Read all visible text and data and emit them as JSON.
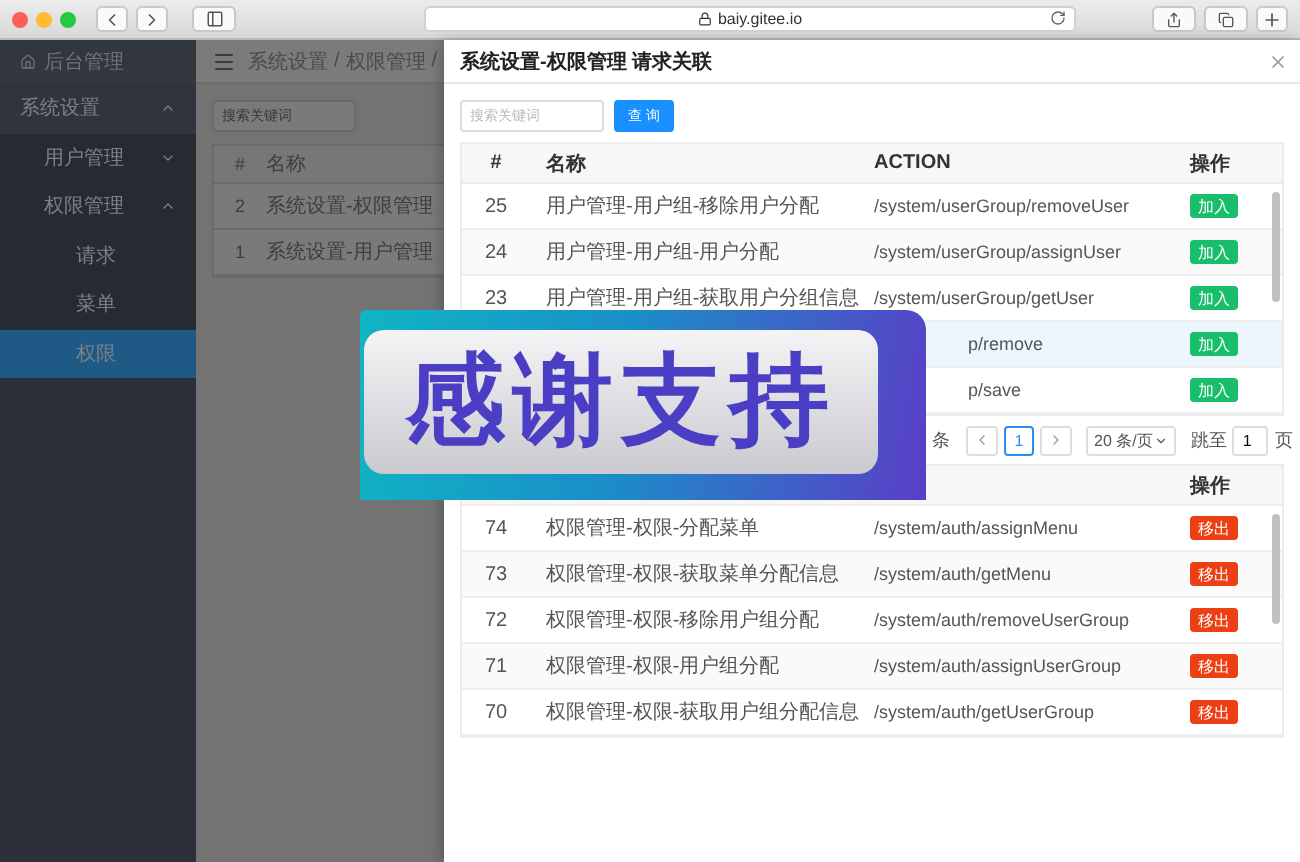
{
  "browser": {
    "url": "baiy.gitee.io"
  },
  "sidebar": {
    "title": "后台管理",
    "items": [
      {
        "label": "系统设置",
        "expanded": true,
        "children": [
          {
            "label": "用户管理",
            "expanded": false
          },
          {
            "label": "权限管理",
            "expanded": true,
            "children": [
              {
                "label": "请求",
                "selected": false
              },
              {
                "label": "菜单",
                "selected": false
              },
              {
                "label": "权限",
                "selected": true
              }
            ]
          }
        ]
      }
    ]
  },
  "main": {
    "breadcrumb": [
      "系统设置",
      "/",
      "权限管理",
      "/"
    ],
    "search": {
      "placeholder": "搜索关键词"
    },
    "table": {
      "columns": [
        "#",
        "名称"
      ],
      "rows": [
        [
          "2",
          "系统设置-权限管理"
        ],
        [
          "1",
          "系统设置-用户管理"
        ]
      ]
    }
  },
  "drawer": {
    "title": "系统设置-权限管理 请求关联",
    "search": {
      "placeholder": "搜索关键词"
    },
    "query_button": "查 询",
    "available": {
      "kind": "add",
      "columns": [
        "#",
        "名称",
        "ACTION",
        "操作"
      ],
      "rows": [
        {
          "id": "25",
          "name": "用户管理-用户组-移除用户分配",
          "action": "/system/userGroup/removeUser",
          "button": "加入",
          "highlighted": false,
          "covered": false
        },
        {
          "id": "24",
          "name": "用户管理-用户组-用户分配",
          "action": "/system/userGroup/assignUser",
          "button": "加入",
          "highlighted": false,
          "covered": false
        },
        {
          "id": "23",
          "name": "用户管理-用户组-获取用户分组信息",
          "action": "/system/userGroup/getUser",
          "button": "加入",
          "highlighted": false,
          "covered": false
        },
        {
          "action": "p/remove",
          "button": "加入",
          "highlighted": true,
          "covered": true
        },
        {
          "action": "p/save",
          "button": "加入",
          "highlighted": false,
          "covered": true
        }
      ]
    },
    "pagination": {
      "total": "条",
      "pages": [
        {
          "label": "1",
          "selected": true
        }
      ],
      "page_size": "20 条/页",
      "jump_label": "跳至",
      "jump_value": "1",
      "page_suffix": "页"
    },
    "assigned": {
      "kind": "remove",
      "columns": [
        "操作"
      ],
      "rows": [
        {
          "id": "74",
          "name": "权限管理-权限-分配菜单",
          "action": "/system/auth/assignMenu",
          "button": "移出",
          "highlighted": false,
          "covered": false
        },
        {
          "id": "73",
          "name": "权限管理-权限-获取菜单分配信息",
          "action": "/system/auth/getMenu",
          "button": "移出",
          "highlighted": false,
          "covered": false
        },
        {
          "id": "72",
          "name": "权限管理-权限-移除用户组分配",
          "action": "/system/auth/removeUserGroup",
          "button": "移出",
          "highlighted": false,
          "covered": false
        },
        {
          "id": "71",
          "name": "权限管理-权限-用户组分配",
          "action": "/system/auth/assignUserGroup",
          "button": "移出",
          "highlighted": false,
          "covered": false
        },
        {
          "id": "70",
          "name": "权限管理-权限-获取用户组分配信息",
          "action": "/system/auth/getUserGroup",
          "button": "移出",
          "highlighted": false,
          "covered": false
        }
      ]
    }
  },
  "sticker": {
    "text": "感谢支持"
  }
}
